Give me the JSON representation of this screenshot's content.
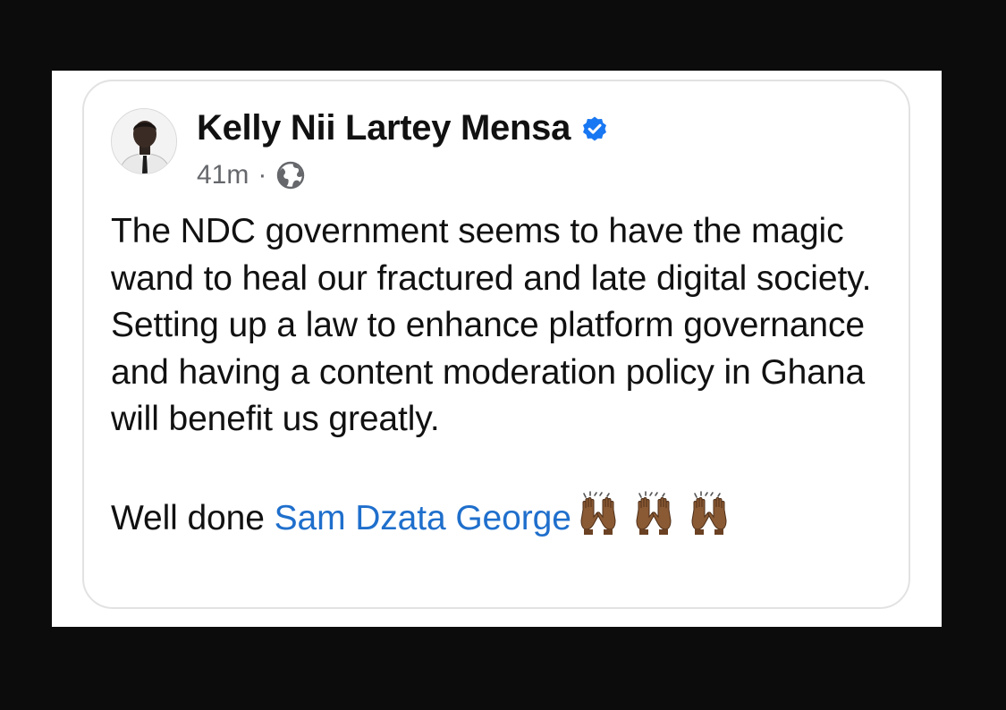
{
  "post": {
    "author": {
      "name": "Kelly Nii Lartey Mensa",
      "verified": true,
      "avatar_icon": "person-photo"
    },
    "timestamp": "41m",
    "separator": "·",
    "audience_icon": "globe-icon",
    "body_paragraph": "The NDC government seems to have the magic wand to heal our fractured and late digital society. Setting up a law to enhance platform governance and having a content moderation policy in Ghana will benefit us greatly.",
    "closing_prefix": "Well done",
    "mention": "Sam Dzata George",
    "emoji": "🙌🏾🙌🏾🙌🏾"
  },
  "colors": {
    "background": "#0c0c0c",
    "card": "#ffffff",
    "mention": "#1f6fcc",
    "verified": "#1877f2",
    "meta": "#65676b"
  }
}
